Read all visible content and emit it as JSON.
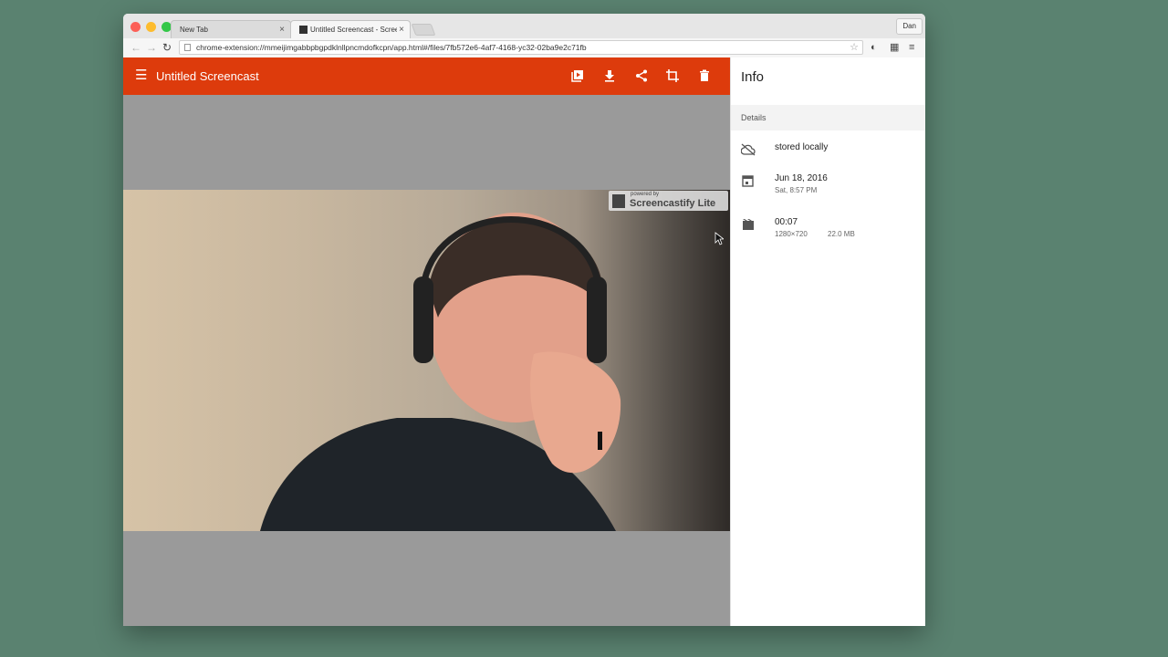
{
  "browser": {
    "tabs": [
      {
        "label": "New Tab",
        "active": false
      },
      {
        "label": "Untitled Screencast - Screencastify",
        "active": true
      }
    ],
    "profile_label": "Dan",
    "url": "chrome-extension://mmeijimgabbpbgpdklnllpncmdofkcpn/app.html#/files/7fb572e6-4af7-4168-yc32-02ba9e2c71fb"
  },
  "appbar": {
    "title": "Untitled Screencast",
    "actions": [
      "open-in-player-icon",
      "download-icon",
      "share-icon",
      "crop-icon",
      "delete-icon"
    ],
    "color": "#dd3b0c"
  },
  "video": {
    "watermark_small": "powered by",
    "watermark_big": "Screencastify Lite"
  },
  "info": {
    "title": "Info",
    "section_label": "Details",
    "storage": "stored locally",
    "date": "Jun 18, 2016",
    "time": "Sat, 8:57 PM",
    "duration": "00:07",
    "resolution": "1280×720",
    "size": "22.0 MB"
  }
}
